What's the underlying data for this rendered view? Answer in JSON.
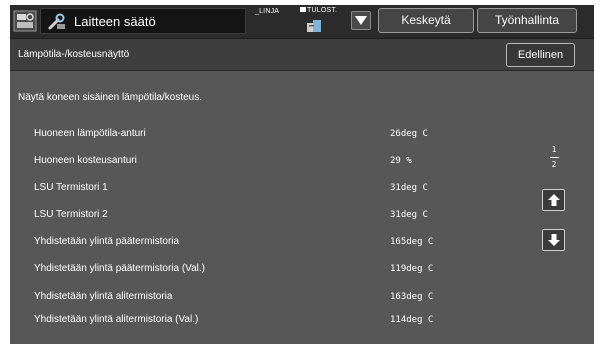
{
  "header": {
    "title": "Laitteen säätö",
    "linja_label": "_LINJA",
    "tulost_label": "TULOST.",
    "pause_button": "Keskeytä",
    "job_button": "Työnhallinta"
  },
  "subheader": {
    "title": "Lämpötila-/kosteusnäyttö",
    "back_button": "Edellinen"
  },
  "intro": "Näytä koneen sisäinen lämpötila/kosteus.",
  "rows": [
    {
      "label": "Huoneen lämpötila-anturi",
      "value": "26deg C"
    },
    {
      "label": "Huoneen kosteusanturi",
      "value": "29 %"
    },
    {
      "label": "LSU Termistori 1",
      "value": "31deg C"
    },
    {
      "label": "LSU Termistori 2",
      "value": "31deg C"
    },
    {
      "label": "Yhdistetään ylintä päätermistoria",
      "value": "165deg C"
    },
    {
      "label": "Yhdistetään ylintä päätermistoria (Val.)",
      "value": "119deg C"
    },
    {
      "label": "Yhdistetään ylintä alitermistoria",
      "value": "163deg C"
    },
    {
      "label": "Yhdistetään ylintä alitermistoria (Val.)",
      "value": "114deg C"
    }
  ],
  "pager": {
    "current": "1",
    "total": "2"
  },
  "icons": {
    "app": "device-settings-icon",
    "title": "tools-icon",
    "tulost": "print-status-icon",
    "dropdown": "triangle-down-icon",
    "up": "arrow-up-icon",
    "down": "arrow-down-icon"
  },
  "colors": {
    "screen_bg": "#575757",
    "header_bg": "#2b2b2b",
    "subheader_bg": "#3e3e3e",
    "text": "#ffffff"
  }
}
